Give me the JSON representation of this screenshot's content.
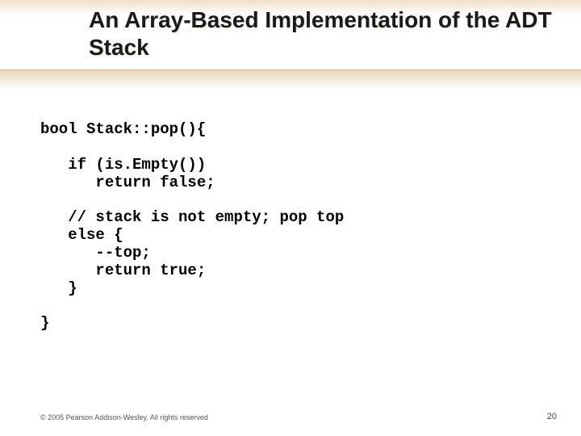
{
  "header": {
    "title": "An Array-Based Implementation of\nthe ADT Stack"
  },
  "code": {
    "line1": "bool Stack::pop(){",
    "line2": "",
    "line3": "   if (is.Empty())",
    "line4": "      return false;",
    "line5": "",
    "line6": "   // stack is not empty; pop top",
    "line7": "   else {",
    "line8": "      --top;",
    "line9": "      return true;",
    "line10": "   }",
    "line11": "",
    "line12": "}"
  },
  "footer": {
    "copyright": "© 2005 Pearson Addison-Wesley. All rights reserved",
    "page": "20"
  }
}
